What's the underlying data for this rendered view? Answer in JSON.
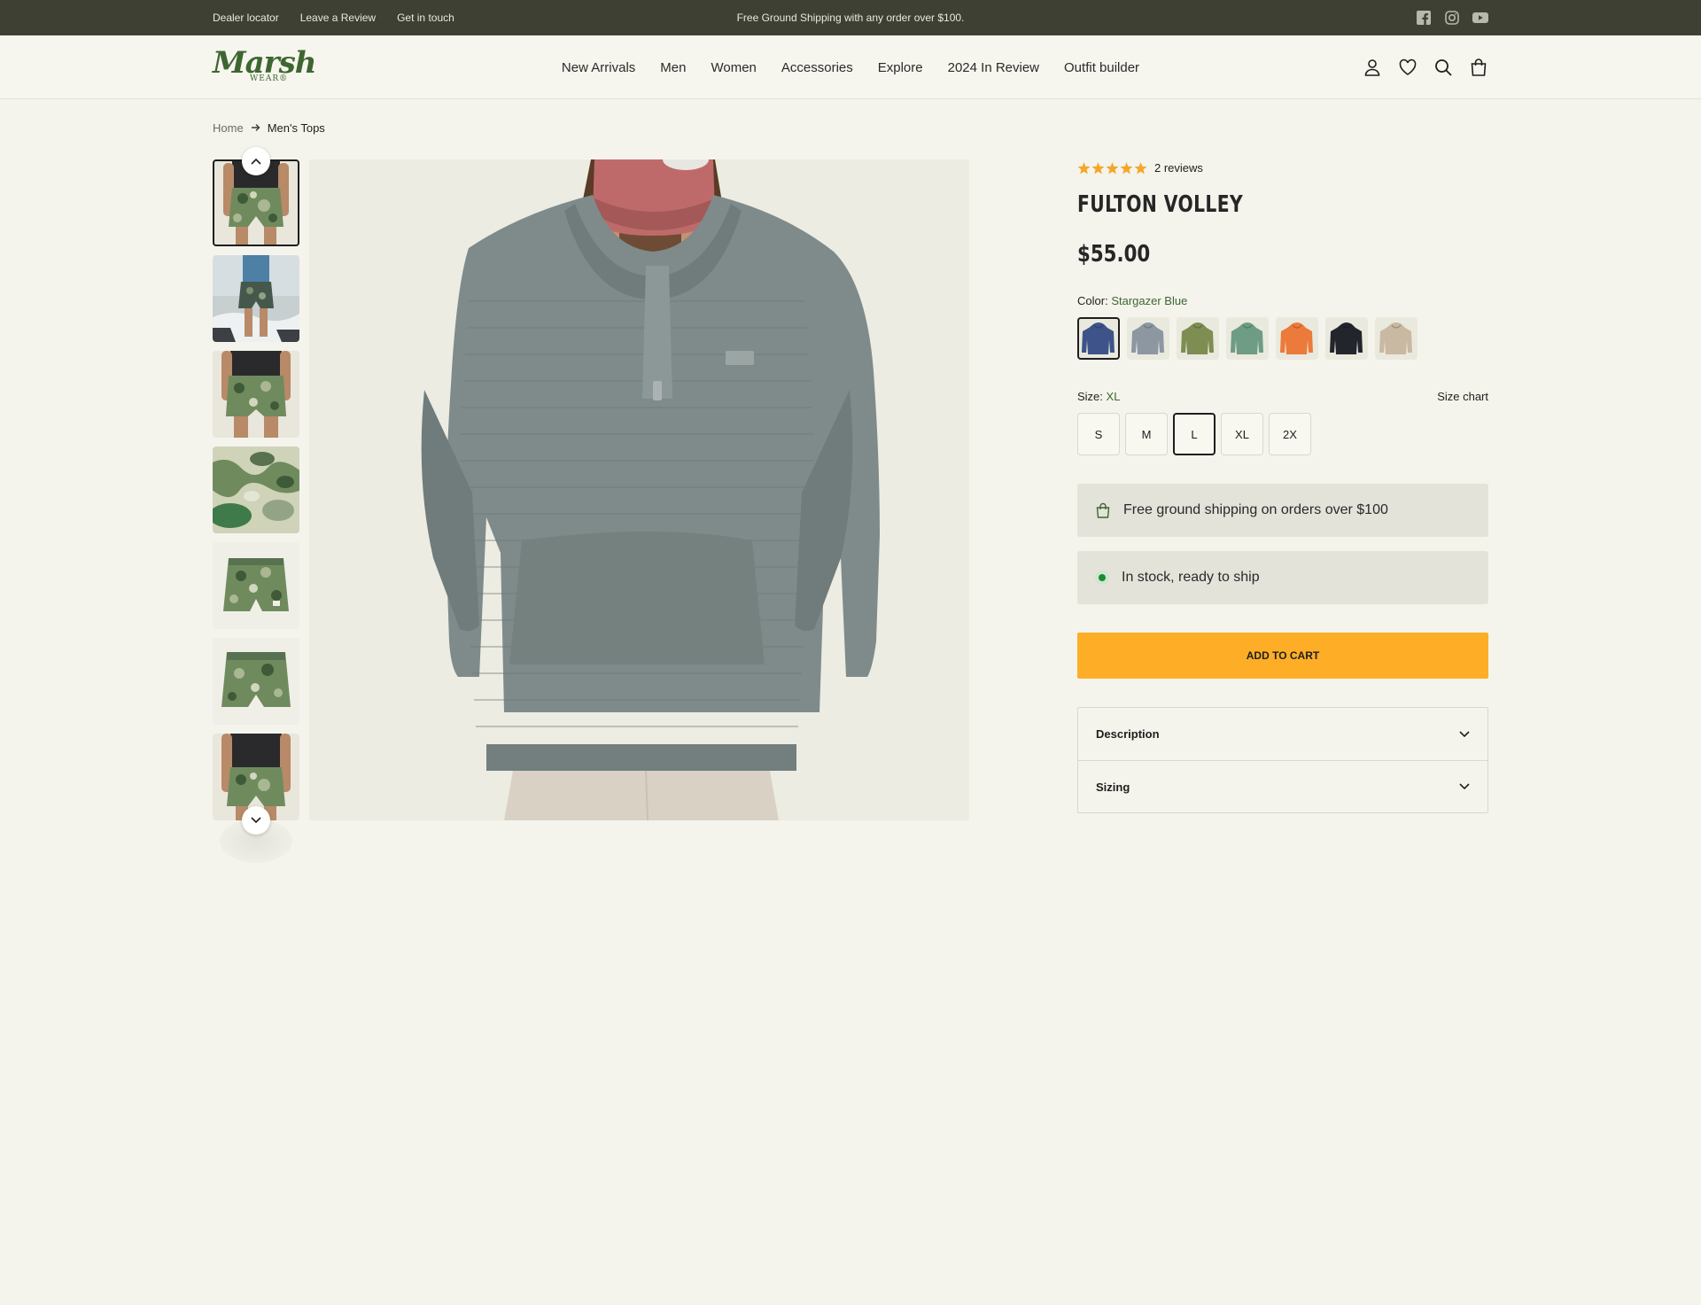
{
  "topbar": {
    "links": [
      "Dealer locator",
      "Leave a Review",
      "Get in touch"
    ],
    "promo": "Free Ground Shipping with any order over $100.",
    "social_icons": [
      "facebook-icon",
      "instagram-icon",
      "youtube-icon"
    ]
  },
  "header": {
    "logo_script": "Marsh",
    "logo_wear": "WEAR®",
    "nav": [
      "New Arrivals",
      "Men",
      "Women",
      "Accessories",
      "Explore",
      "2024 In Review",
      "Outfit builder"
    ],
    "icons": [
      "account-icon",
      "wishlist-icon",
      "search-icon",
      "cart-icon"
    ]
  },
  "breadcrumb": {
    "home": "Home",
    "current": "Men's Tops"
  },
  "gallery": {
    "thumb_count": 7,
    "active_thumb": 0
  },
  "product": {
    "rating": 5,
    "reviews": "2 reviews",
    "title": "FULTON VOLLEY",
    "price": "$55.00",
    "color_label": "Color:",
    "color_value": "Stargazer Blue",
    "swatch_colors": [
      "#3e5389",
      "#8c97a2",
      "#7e8d52",
      "#6e9c84",
      "#ec7a3b",
      "#23252c",
      "#c9b9a2"
    ],
    "active_swatch": 0,
    "size_label": "Size:",
    "size_value": "XL",
    "size_chart": "Size chart",
    "sizes": [
      "S",
      "M",
      "L",
      "XL",
      "2X"
    ],
    "active_size": "L",
    "shipping_notice": "Free ground shipping on orders over $100",
    "stock_notice": "In stock, ready to ship",
    "add_to_cart": "ADD TO CART",
    "accordion": [
      "Description",
      "Sizing"
    ]
  },
  "colors": {
    "topbar_bg": "#3e4033",
    "brand_green": "#3e6631",
    "cta": "#fdae26",
    "star": "#f4a62a",
    "page_bg": "#f4f4ec"
  }
}
